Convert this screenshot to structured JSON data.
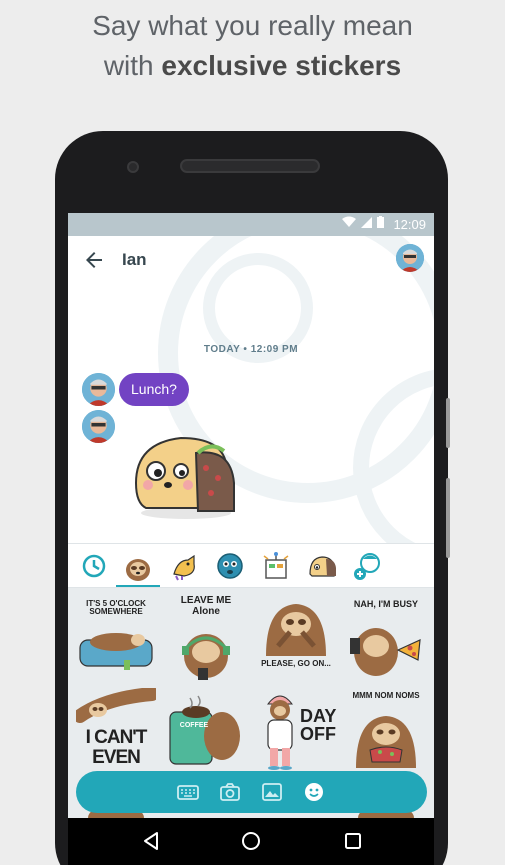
{
  "headline": {
    "line1": "Say what you really mean",
    "line2_prefix": "with ",
    "line2_bold": "exclusive stickers"
  },
  "status_bar": {
    "time": "12:09",
    "icons": [
      "wifi-icon",
      "signal-icon",
      "battery-icon"
    ]
  },
  "app_bar": {
    "back_icon": "arrow-left-icon",
    "contact_name": "Ian"
  },
  "conversation": {
    "timestamp": "TODAY • 12:09 PM",
    "messages": [
      {
        "type": "text",
        "text": "Lunch?"
      },
      {
        "type": "sticker",
        "sticker": "taco-dog-sticker"
      }
    ]
  },
  "sticker_tray": {
    "tabs": [
      "recent-clock-icon",
      "sloth-pack",
      "dog-pack",
      "blob-pack",
      "robot-pack",
      "taco-pack",
      "add-pack-icon"
    ],
    "selected": "sloth-pack"
  },
  "sticker_grid": {
    "stickers": [
      {
        "name": "five-oclock-somewhere-sticker",
        "caption": "IT'S 5 O'CLOCK SOMEWHERE"
      },
      {
        "name": "leave-me-alone-sticker",
        "caption": "LEAVE ME Alone"
      },
      {
        "name": "please-go-on-sticker",
        "caption": "PLEASE, GO ON..."
      },
      {
        "name": "nah-im-busy-sticker",
        "caption": "NAH, I'M BUSY"
      },
      {
        "name": "i-cant-even-sticker",
        "caption": "I CAN'T EVEN"
      },
      {
        "name": "coffee-sticker",
        "caption": "COFFEE"
      },
      {
        "name": "day-off-sticker",
        "caption": "DAY OFF"
      },
      {
        "name": "mmm-nom-noms-sticker",
        "caption": "MMM NOM NOMS"
      }
    ]
  },
  "compose_bar": {
    "icons": [
      "keyboard-icon",
      "camera-icon",
      "image-icon",
      "sticker-icon"
    ]
  },
  "nav_bar": {
    "buttons": [
      "back-triangle-icon",
      "home-circle-icon",
      "recents-square-icon"
    ]
  },
  "colors": {
    "accent": "#22a7b8",
    "bubble": "#7243c3",
    "status_bar": "#b8c6cc"
  }
}
